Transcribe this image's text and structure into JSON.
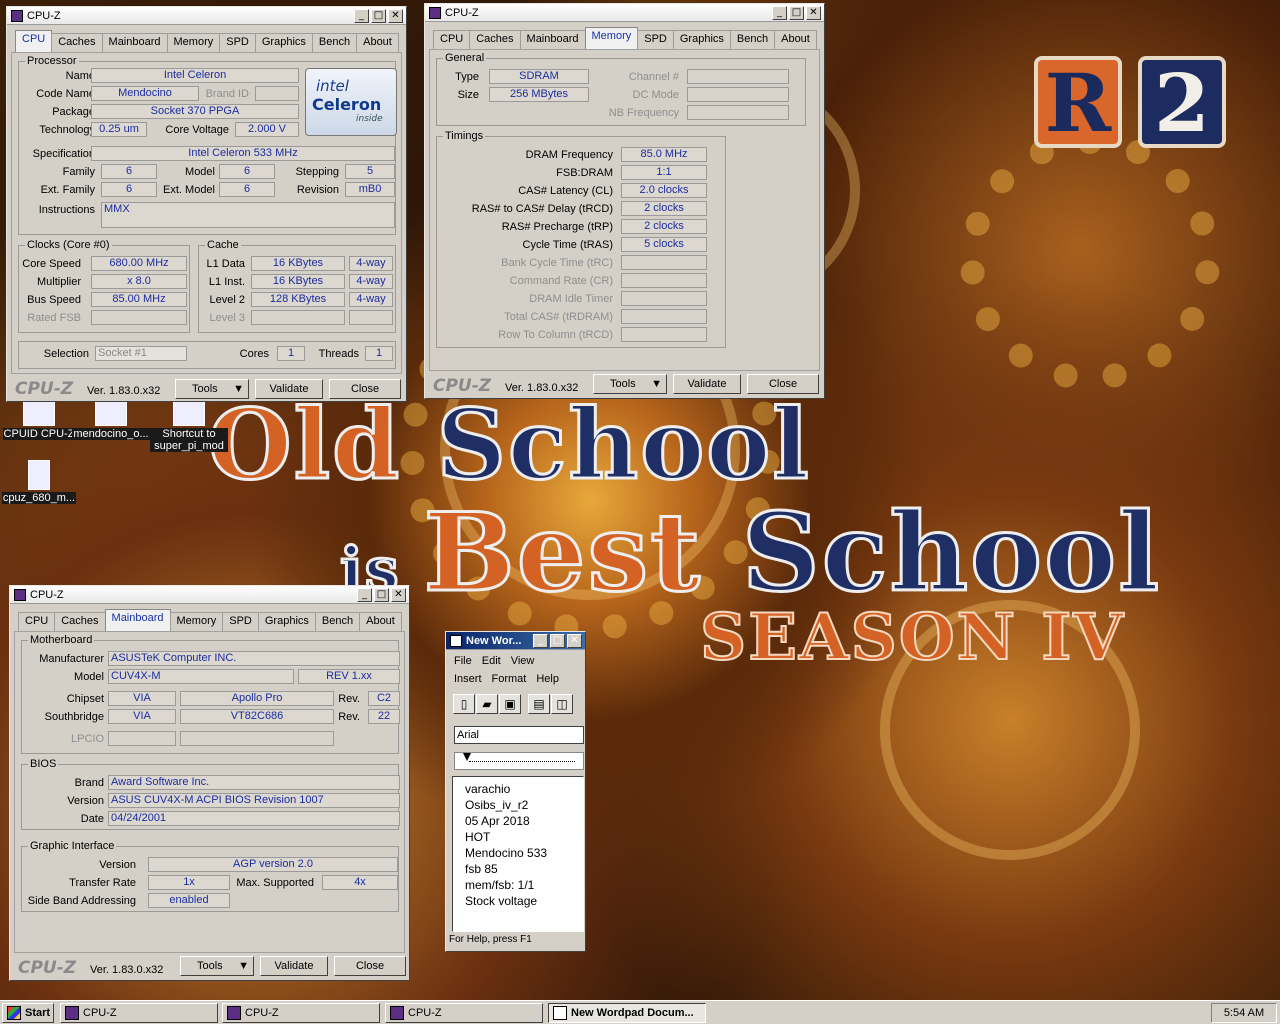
{
  "wallpaper": {
    "r2_letter": "R",
    "r2_digit": "2",
    "title_line1a": "Old ",
    "title_line1b": "School",
    "title_line2a": "is ",
    "title_line2b": "Best ",
    "title_line2c": "School",
    "title_line3": "SEASON IV"
  },
  "desktop_icons": [
    "CPUID CPU-Z",
    "mendocino_o...",
    "Shortcut to super_pi_mod",
    "cpuz_680_m..."
  ],
  "cpuz_common": {
    "title": "CPU-Z",
    "logo": "CPU-Z",
    "version": "Ver. 1.83.0.x32",
    "tools": "Tools",
    "validate": "Validate",
    "close": "Close",
    "tabs": [
      "CPU",
      "Caches",
      "Mainboard",
      "Memory",
      "SPD",
      "Graphics",
      "Bench",
      "About"
    ],
    "minimize": "_",
    "maximize": "□",
    "close_x": "✕"
  },
  "cpu": {
    "processor_label": "Processor",
    "name_l": "Name",
    "name": "Intel Celeron",
    "codename_l": "Code Name",
    "codename": "Mendocino",
    "brandid_l": "Brand ID",
    "package_l": "Package",
    "package": "Socket 370 PPGA",
    "technology_l": "Technology",
    "technology": "0.25 um",
    "corevoltage_l": "Core Voltage",
    "corevoltage": "2.000 V",
    "spec_l": "Specification",
    "spec": "Intel Celeron 533 MHz",
    "family_l": "Family",
    "family": "6",
    "model_l": "Model",
    "model": "6",
    "stepping_l": "Stepping",
    "stepping": "5",
    "extfamily_l": "Ext. Family",
    "extfamily": "6",
    "extmodel_l": "Ext. Model",
    "extmodel": "6",
    "revision_l": "Revision",
    "revision": "mB0",
    "instructions_l": "Instructions",
    "instructions": "MMX",
    "intel_logo1": "intel",
    "intel_logo2": "Celeron",
    "intel_logo3": "inside",
    "clocks_label": "Clocks (Core #0)",
    "corespeed_l": "Core Speed",
    "corespeed": "680.00 MHz",
    "multiplier_l": "Multiplier",
    "multiplier": "x 8.0",
    "busspeed_l": "Bus Speed",
    "busspeed": "85.00 MHz",
    "ratedfsb_l": "Rated FSB",
    "cache_label": "Cache",
    "l1d_l": "L1 Data",
    "l1d": "16 KBytes",
    "l1d_w": "4-way",
    "l1i_l": "L1 Inst.",
    "l1i": "16 KBytes",
    "l1i_w": "4-way",
    "l2_l": "Level 2",
    "l2": "128 KBytes",
    "l2_w": "4-way",
    "l3_l": "Level 3",
    "selection_l": "Selection",
    "selection": "Socket #1",
    "cores_l": "Cores",
    "cores": "1",
    "threads_l": "Threads",
    "threads": "1"
  },
  "memory": {
    "general_label": "General",
    "type_l": "Type",
    "type": "SDRAM",
    "size_l": "Size",
    "size": "256 MBytes",
    "channel_l": "Channel #",
    "dcmode_l": "DC Mode",
    "nbfreq_l": "NB Frequency",
    "timings_label": "Timings",
    "dram_l": "DRAM Frequency",
    "dram": "85.0 MHz",
    "fsbdram_l": "FSB:DRAM",
    "fsbdram": "1:1",
    "cas_l": "CAS# Latency (CL)",
    "cas": "2.0 clocks",
    "trcd_l": "RAS# to CAS# Delay (tRCD)",
    "trcd": "2 clocks",
    "trp_l": "RAS# Precharge (tRP)",
    "trp": "2 clocks",
    "tras_l": "Cycle Time (tRAS)",
    "tras": "5 clocks",
    "trc_l": "Bank Cycle Time (tRC)",
    "cr_l": "Command Rate (CR)",
    "idle_l": "DRAM Idle Timer",
    "trdram_l": "Total CAS# (tRDRAM)",
    "rowcol_l": "Row To Column (tRCD)"
  },
  "mainboard": {
    "mb_label": "Motherboard",
    "manufacturer_l": "Manufacturer",
    "manufacturer": "ASUSTeK Computer INC.",
    "model_l": "Model",
    "model": "CUV4X-M",
    "model_rev": "REV 1.xx",
    "chipset_l": "Chipset",
    "chipset_v": "VIA",
    "chipset_n": "Apollo Pro",
    "rev_l": "Rev.",
    "chipset_rev": "C2",
    "sb_l": "Southbridge",
    "sb_v": "VIA",
    "sb_n": "VT82C686",
    "sb_rev": "22",
    "lpcio_l": "LPCIO",
    "bios_label": "BIOS",
    "brand_l": "Brand",
    "brand": "Award Software Inc.",
    "version_l": "Version",
    "version": "ASUS CUV4X-M ACPI BIOS Revision 1007",
    "date_l": "Date",
    "date": "04/24/2001",
    "gi_label": "Graphic Interface",
    "giver_l": "Version",
    "giver": "AGP version 2.0",
    "rate_l": "Transfer Rate",
    "rate": "1x",
    "maxsup_l": "Max. Supported",
    "maxsup": "4x",
    "sba_l": "Side Band Addressing",
    "sba": "enabled"
  },
  "wordpad": {
    "title": "New Wor...",
    "menu1": [
      "File",
      "Edit",
      "View"
    ],
    "menu2": [
      "Insert",
      "Format",
      "Help"
    ],
    "font": "Arial",
    "lines": [
      "varachio",
      "Osibs_iv_r2",
      "05 Apr 2018",
      "HOT",
      "Mendocino 533",
      "fsb 85",
      "mem/fsb: 1/1",
      "Stock voltage"
    ],
    "status": "For Help, press F1"
  },
  "taskbar": {
    "start": "Start",
    "items": [
      "CPU-Z",
      "CPU-Z",
      "CPU-Z",
      "New Wordpad Docum..."
    ],
    "clock": "5:54 AM"
  }
}
